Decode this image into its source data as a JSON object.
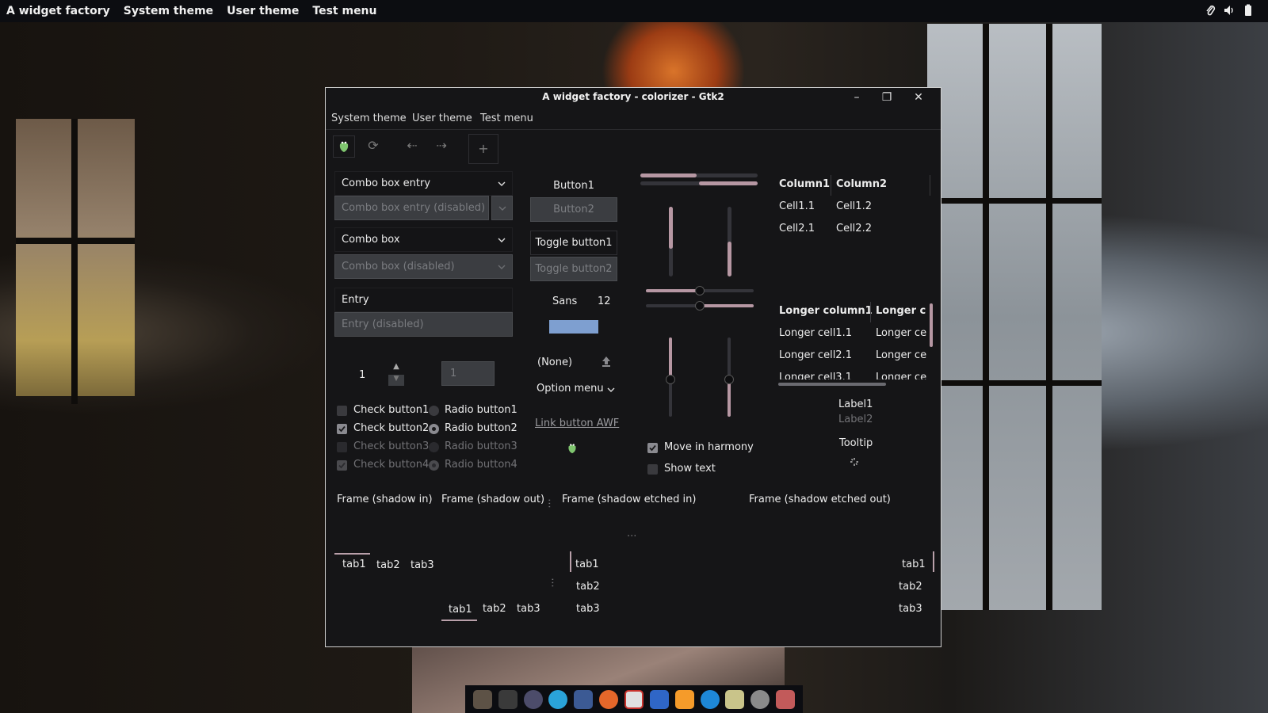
{
  "topbar": {
    "app_title": "A widget factory",
    "menu": [
      "System theme",
      "User theme",
      "Test menu"
    ],
    "tray_icons": [
      "paperclip-icon",
      "volume-icon",
      "battery-icon"
    ]
  },
  "window": {
    "title": "A widget factory - colorizer - Gtk2",
    "controls": {
      "minimize": "–",
      "maximize": "❐",
      "close": "✕"
    },
    "menu": [
      "System theme",
      "User theme",
      "Test menu"
    ],
    "toolbar": [
      "awf-logo-icon",
      "refresh-icon",
      "back-icon",
      "forward-icon",
      "add-icon"
    ],
    "combos": {
      "combo_box_entry": "Combo box entry",
      "combo_box_entry_disabled": "Combo box entry (disabled)",
      "combo_box": "Combo box",
      "combo_box_disabled": "Combo box (disabled)",
      "entry": "Entry",
      "entry_disabled": "Entry (disabled)"
    },
    "spin": {
      "value1": "1",
      "value2": "1"
    },
    "checks": [
      {
        "label": "Check button1",
        "checked": false,
        "disabled": false
      },
      {
        "label": "Check button2",
        "checked": true,
        "disabled": false
      },
      {
        "label": "Check button3",
        "checked": false,
        "disabled": true
      },
      {
        "label": "Check button4",
        "checked": true,
        "disabled": true
      }
    ],
    "radios": [
      {
        "label": "Radio button1",
        "checked": false,
        "disabled": false
      },
      {
        "label": "Radio button2",
        "checked": true,
        "disabled": false
      },
      {
        "label": "Radio button3",
        "checked": false,
        "disabled": true
      },
      {
        "label": "Radio button4",
        "checked": true,
        "disabled": true
      }
    ],
    "buttons": {
      "button1": "Button1",
      "button2": "Button2",
      "toggle1": "Toggle button1",
      "toggle2": "Toggle button2"
    },
    "font": {
      "family": "Sans",
      "size": "12"
    },
    "file_chooser": "(None)",
    "option_menu": "Option menu",
    "link_button": "Link button AWF",
    "progress": {
      "horizontal1": 0.48,
      "horizontal2": 0.5,
      "vertical1": 0.6,
      "vertical2": 0.5
    },
    "harmony": {
      "move_in_harmony": "Move in harmony",
      "show_text": "Show text",
      "move_checked": true,
      "show_checked": false
    },
    "tree1": {
      "columns": [
        "Column1",
        "Column2"
      ],
      "rows": [
        [
          "Cell1.1",
          "Cell1.2"
        ],
        [
          "Cell2.1",
          "Cell2.2"
        ]
      ]
    },
    "tree2": {
      "columns": [
        "Longer column1",
        "Longer c"
      ],
      "rows": [
        [
          "Longer cell1.1",
          "Longer ce"
        ],
        [
          "Longer cell2.1",
          "Longer ce"
        ],
        [
          "Longer cell3.1",
          "Longer ce"
        ]
      ]
    },
    "labels": {
      "label1": "Label1",
      "label2": "Label2",
      "tooltip": "Tooltip"
    },
    "frames": [
      "Frame (shadow in)",
      "Frame (shadow out)",
      "Frame (shadow etched in)",
      "Frame (shadow etched out)"
    ],
    "tabs_top": [
      "tab1",
      "tab2",
      "tab3"
    ],
    "tabs_bottom": [
      "tab1",
      "tab2",
      "tab3"
    ],
    "tabs_left": [
      "tab1",
      "tab2",
      "tab3"
    ],
    "tabs_right": [
      "tab1",
      "tab2",
      "tab3"
    ],
    "ellipsis": "..."
  },
  "dock_icons": [
    "gimp-icon",
    "inkscape-icon",
    "palette-icon",
    "telegram-icon",
    "tex-icon",
    "firefox-icon",
    "downloader-icon",
    "book-icon",
    "sublime-icon",
    "search-icon",
    "files-icon",
    "hash-icon",
    "avatar-icon"
  ],
  "colors": {
    "accent": "#b697a3",
    "window_bg": "#151517",
    "disabled_bg": "#3b3d41"
  }
}
